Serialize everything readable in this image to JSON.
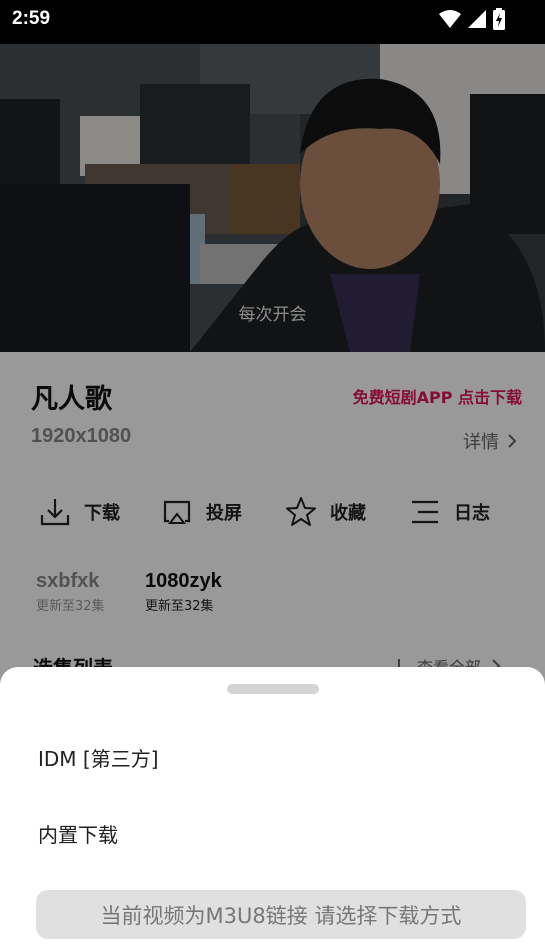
{
  "status_bar": {
    "time": "2:59",
    "icons": [
      "wifi-icon",
      "signal-icon",
      "battery-charging-icon"
    ]
  },
  "video": {
    "subtitle": "每次开会"
  },
  "show": {
    "title": "凡人歌",
    "resolution": "1920x1080",
    "promo": "免费短剧APP 点击下载",
    "detail_label": "详情"
  },
  "actions": [
    {
      "label": "下载",
      "icon": "download-icon"
    },
    {
      "label": "投屏",
      "icon": "cast-icon"
    },
    {
      "label": "收藏",
      "icon": "star-icon"
    },
    {
      "label": "日志",
      "icon": "list-icon"
    }
  ],
  "sources": [
    {
      "name": "sxbfxk",
      "update": "更新至32集",
      "selected": false
    },
    {
      "name": "1080zyk",
      "update": "更新至32集",
      "selected": true
    }
  ],
  "episodes": {
    "title": "选集列表",
    "view_all": "查看全部"
  },
  "download_sheet": {
    "options": [
      "IDM [第三方]",
      "内置下载"
    ],
    "toast": "当前视频为M3U8链接 请选择下载方式"
  },
  "colors": {
    "promo": "#e0165b",
    "overlay": "rgba(0,0,0,0.40)",
    "toast_bg": "#e0e0e0"
  }
}
